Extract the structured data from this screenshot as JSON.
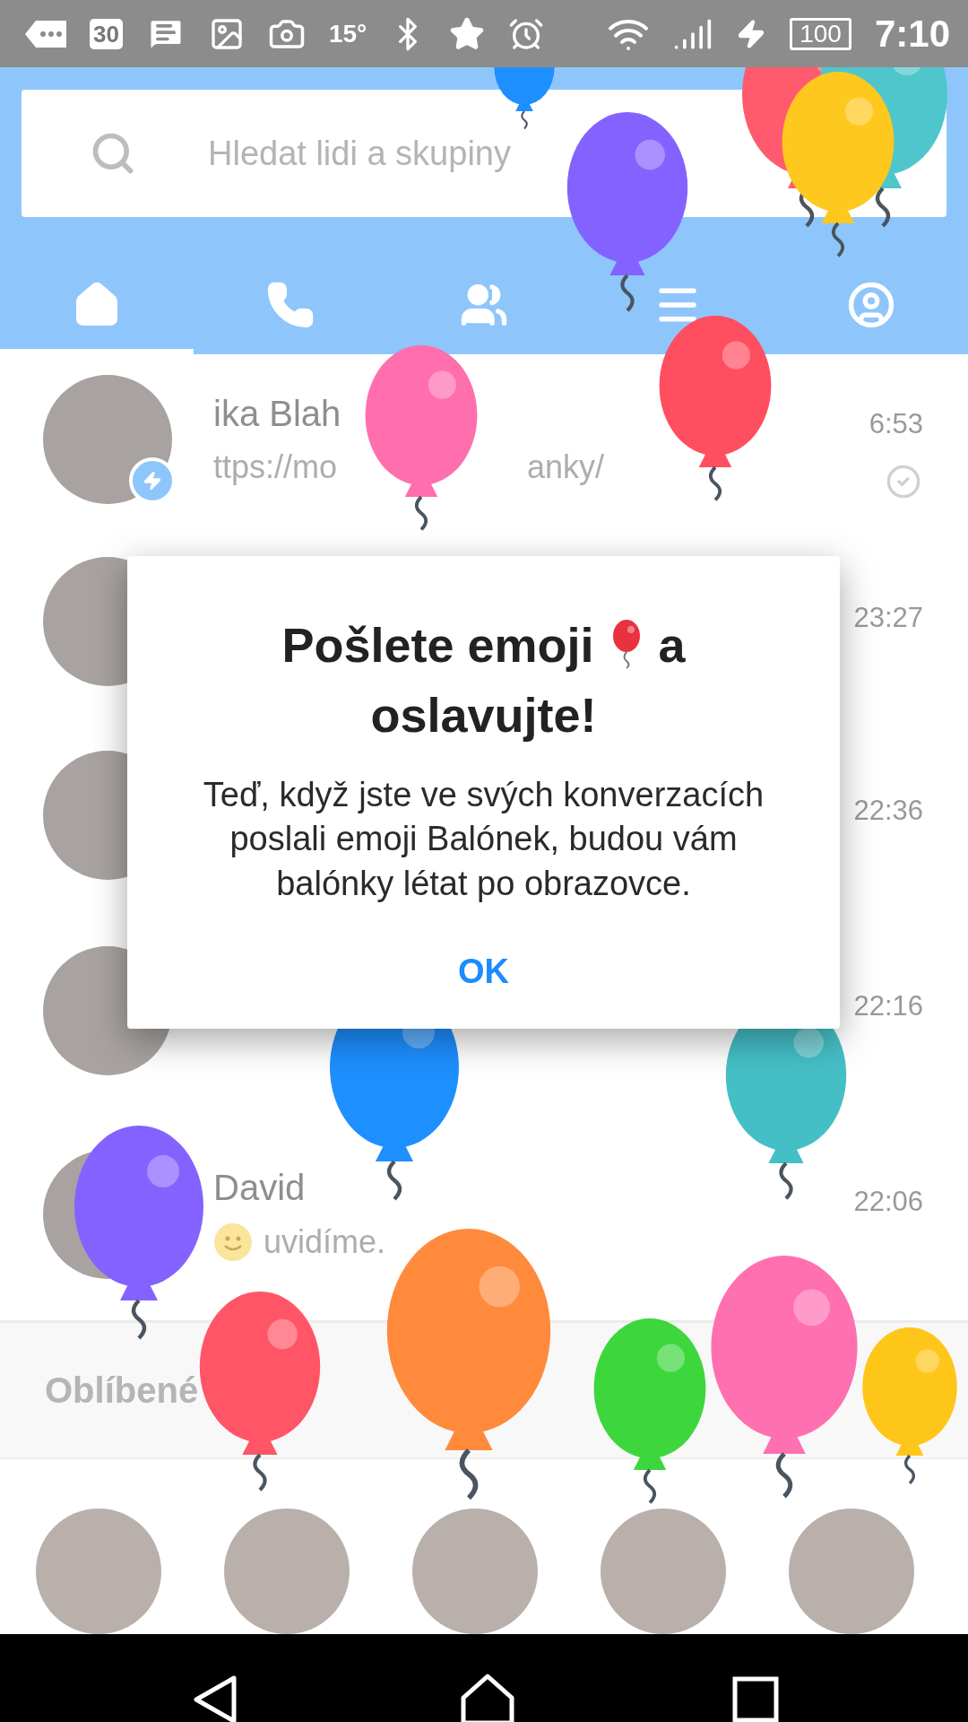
{
  "status_bar": {
    "calendar_day": "30",
    "temperature": "15°",
    "battery": "100",
    "time": "7:10"
  },
  "search": {
    "placeholder": "Hledat lidi a skupiny"
  },
  "tabs": [
    {
      "kind": "home",
      "selected": true
    },
    {
      "kind": "calls",
      "selected": false
    },
    {
      "kind": "groups",
      "selected": false
    },
    {
      "kind": "list",
      "selected": false
    },
    {
      "kind": "profile",
      "selected": false
    }
  ],
  "conversations": [
    {
      "name": "ika Blah",
      "preview": [
        "ttps://mo",
        "anky/"
      ],
      "time": "6:53",
      "read": true,
      "emoji": false
    },
    {
      "time": "23:27",
      "read": false,
      "emoji": false
    },
    {
      "time": "22:36",
      "read": false,
      "emoji": false
    },
    {
      "time": "22:16",
      "read": false,
      "emoji": false
    },
    {
      "name": "David",
      "preview": [
        "uvidíme."
      ],
      "time": "22:06",
      "read": false,
      "emoji": true
    }
  ],
  "favorites": {
    "title": "Oblíbené"
  },
  "dialog": {
    "title_start": "Pošlete emoji",
    "title_middle": "a",
    "title_end": "oslavujte!",
    "message": "Teď, když jste ve svých konverzacích poslali emoji Balónek, budou vám balónky létat po obrazovce.",
    "button": "OK"
  },
  "balloons": [
    {
      "color": "#1e8fff"
    },
    {
      "color": "#ff5a6e"
    },
    {
      "color": "#4fc6cc"
    },
    {
      "color": "#8462ff"
    },
    {
      "color": "#ffc81e"
    },
    {
      "color": "#ff4e60"
    },
    {
      "color": "#ff6fae"
    },
    {
      "color": "#45bfc6"
    },
    {
      "color": "#1e8fff"
    },
    {
      "color": "#8462ff"
    },
    {
      "color": "#ff8a3c"
    },
    {
      "color": "#ff5566"
    },
    {
      "color": "#ff70b0"
    },
    {
      "color": "#3dd63d"
    },
    {
      "color": "#ffc61a"
    }
  ]
}
